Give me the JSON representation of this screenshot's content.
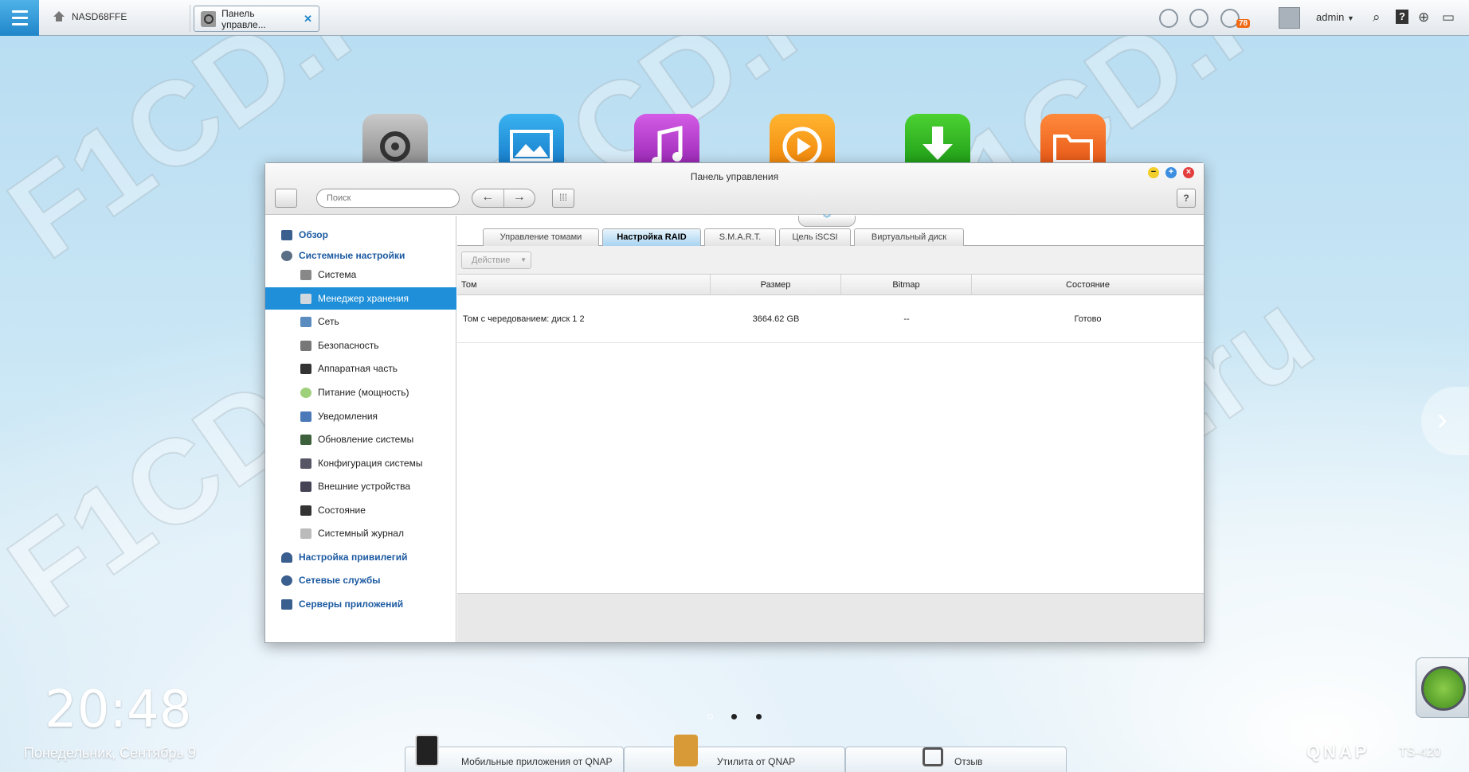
{
  "topbar": {
    "host": "NASD68FFE",
    "task_tab": "Панель управле...",
    "notification_count": "78",
    "user": "admin",
    "user_caret": "▼",
    "icons": [
      "clock-icon",
      "sync-icon",
      "info-icon",
      "avatar",
      "search-icon",
      "help-icon",
      "globe-icon",
      "monitor-icon"
    ]
  },
  "window": {
    "title": "Панель управления",
    "search_placeholder": "Поиск",
    "back": "←",
    "forward": "→",
    "grid": "⁞⁞⁞",
    "help": "?"
  },
  "sidebar": {
    "items": [
      {
        "label": "Обзор",
        "type": "cat"
      },
      {
        "label": "Системные настройки",
        "type": "cat"
      },
      {
        "label": "Система",
        "type": "sub"
      },
      {
        "label": "Менеджер хранения",
        "type": "sub",
        "selected": true
      },
      {
        "label": "Сеть",
        "type": "sub"
      },
      {
        "label": "Безопасность",
        "type": "sub"
      },
      {
        "label": "Аппаратная часть",
        "type": "sub"
      },
      {
        "label": "Питание (мощность)",
        "type": "sub"
      },
      {
        "label": "Уведомления",
        "type": "sub"
      },
      {
        "label": "Обновление системы",
        "type": "sub"
      },
      {
        "label": "Конфигурация системы",
        "type": "sub"
      },
      {
        "label": "Внешние устройства",
        "type": "sub"
      },
      {
        "label": "Состояние",
        "type": "sub"
      },
      {
        "label": "Системный журнал",
        "type": "sub"
      },
      {
        "label": "Настройка привилегий",
        "type": "cat"
      },
      {
        "label": "Сетевые службы",
        "type": "cat"
      },
      {
        "label": "Серверы приложений",
        "type": "cat"
      }
    ]
  },
  "tabs": [
    "Управление томами",
    "Настройка RAID",
    "S.M.A.R.T.",
    "Цель iSCSI",
    "Виртуальный диск"
  ],
  "active_tab": "Настройка RAID",
  "action_button": "Действие",
  "table": {
    "columns": [
      "Том",
      "Размер",
      "Bitmap",
      "Состояние"
    ],
    "rows": [
      [
        "Том с чередованием: диск 1 2",
        "3664.62 GB",
        "--",
        "Готово"
      ]
    ]
  },
  "desktop": {
    "time": "20:48",
    "date": "Понедельник, Сентябрь 9",
    "dock": [
      "Мобильные приложения от QNAP",
      "Утилита от QNAP",
      "Отзыв"
    ],
    "brand": "QNAP",
    "model": "TS-420",
    "watermark": "F1CD.ru"
  },
  "colors": {
    "accent": "#1e8fd8",
    "category_text": "#1c5aa1",
    "badge": "#ef6a16"
  }
}
